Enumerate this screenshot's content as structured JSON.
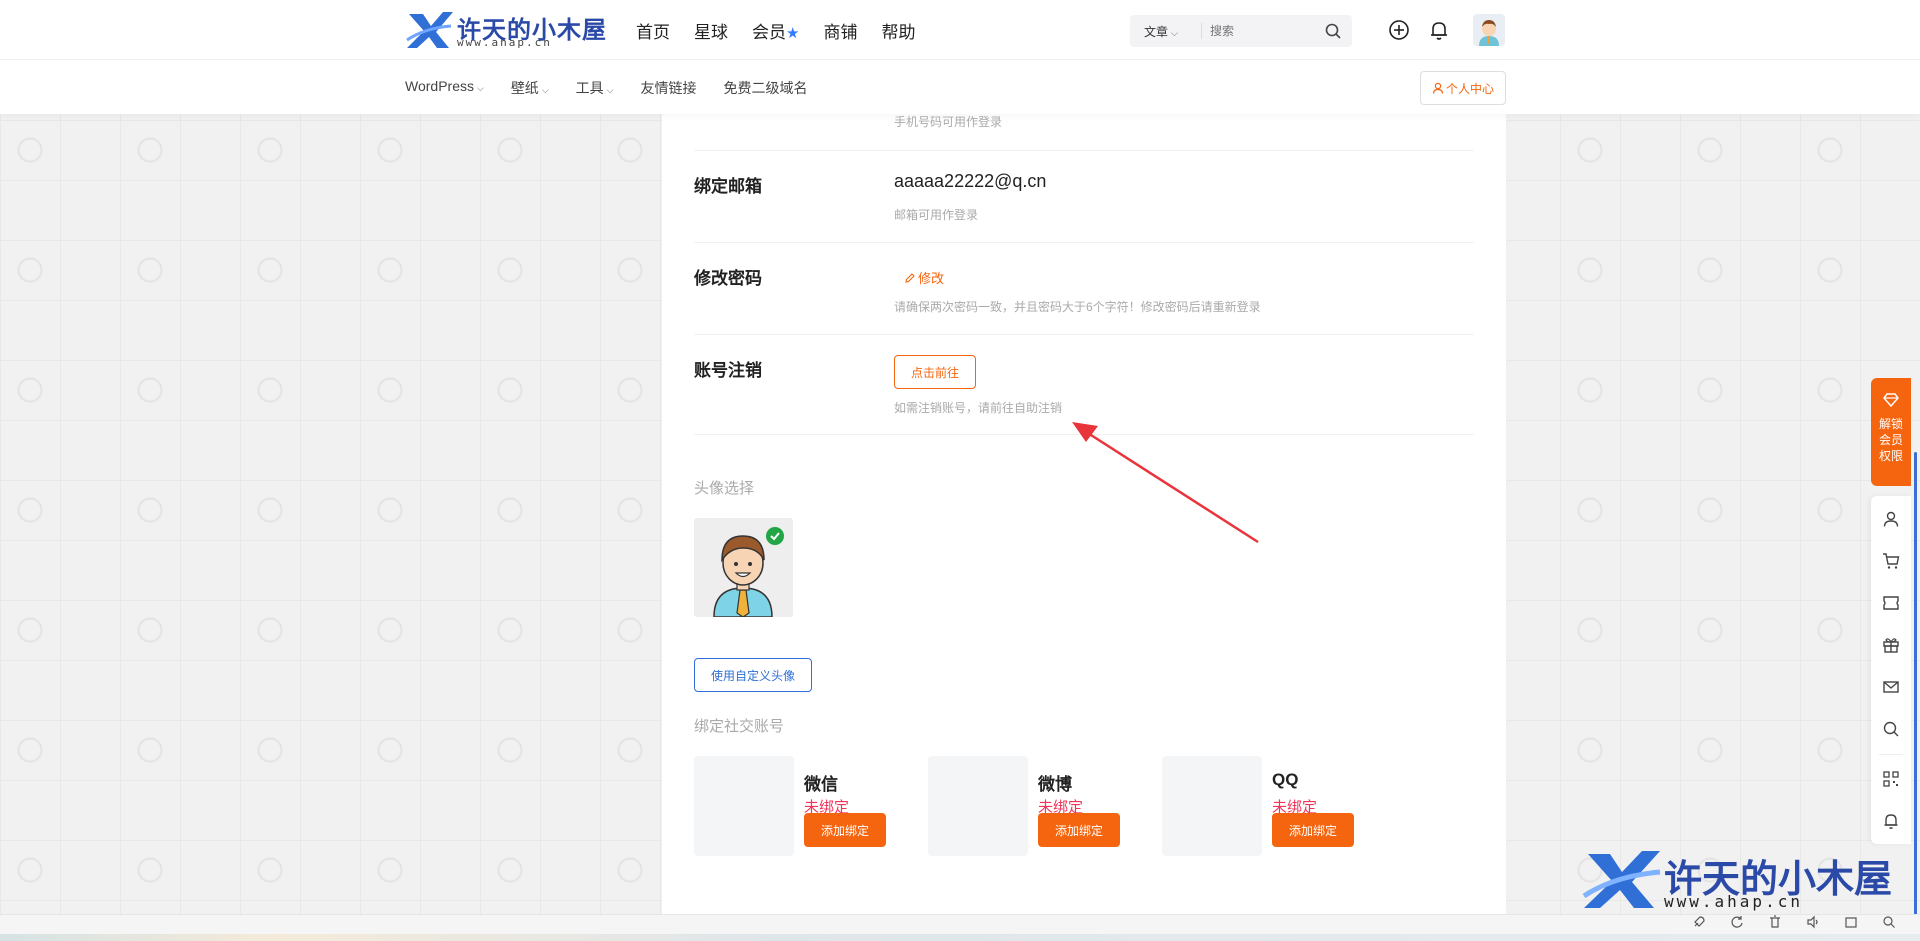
{
  "header": {
    "logo_title": "许天的小木屋",
    "logo_sub": "www.ahap.cn",
    "nav": [
      "首页",
      "星球",
      "会员",
      "商铺",
      "帮助"
    ],
    "search": {
      "category": "文章",
      "placeholder": "搜索"
    },
    "sub_nav": [
      "WordPress",
      "壁纸",
      "工具",
      "友情链接",
      "免费二级域名"
    ],
    "user_center": "个人中心"
  },
  "account": {
    "phone_hint": "手机号码可用作登录",
    "email_label": "绑定邮箱",
    "email_value": "aaaaa22222@q.cn",
    "email_hint": "邮箱可用作登录",
    "password_label": "修改密码",
    "password_edit": "修改",
    "password_hint": "请确保两次密码一致，并且密码大于6个字符！修改密码后请重新登录",
    "cancel_label": "账号注销",
    "cancel_button": "点击前往",
    "cancel_hint": "如需注销账号，请前往自助注销"
  },
  "avatar": {
    "title": "头像选择",
    "custom_button": "使用自定义头像"
  },
  "social": {
    "title": "绑定社交账号",
    "items": [
      {
        "name": "微信",
        "status": "未绑定",
        "button": "添加绑定"
      },
      {
        "name": "微博",
        "status": "未绑定",
        "button": "添加绑定"
      },
      {
        "name": "QQ",
        "status": "未绑定",
        "button": "添加绑定"
      }
    ]
  },
  "sidebar": {
    "vip_tab": "解锁会员权限",
    "icons": [
      "user-icon",
      "cart-icon",
      "ticket-icon",
      "gift-icon",
      "mail-icon",
      "search-icon",
      "qrcode-icon",
      "bell-icon"
    ]
  },
  "watermark": {
    "title": "许天的小木屋",
    "sub": "www.ahap.cn"
  },
  "colors": {
    "accent": "#f5650f",
    "brand": "#2b4aa8",
    "unbound": "#f2335a",
    "link_blue": "#2f6fd6"
  }
}
